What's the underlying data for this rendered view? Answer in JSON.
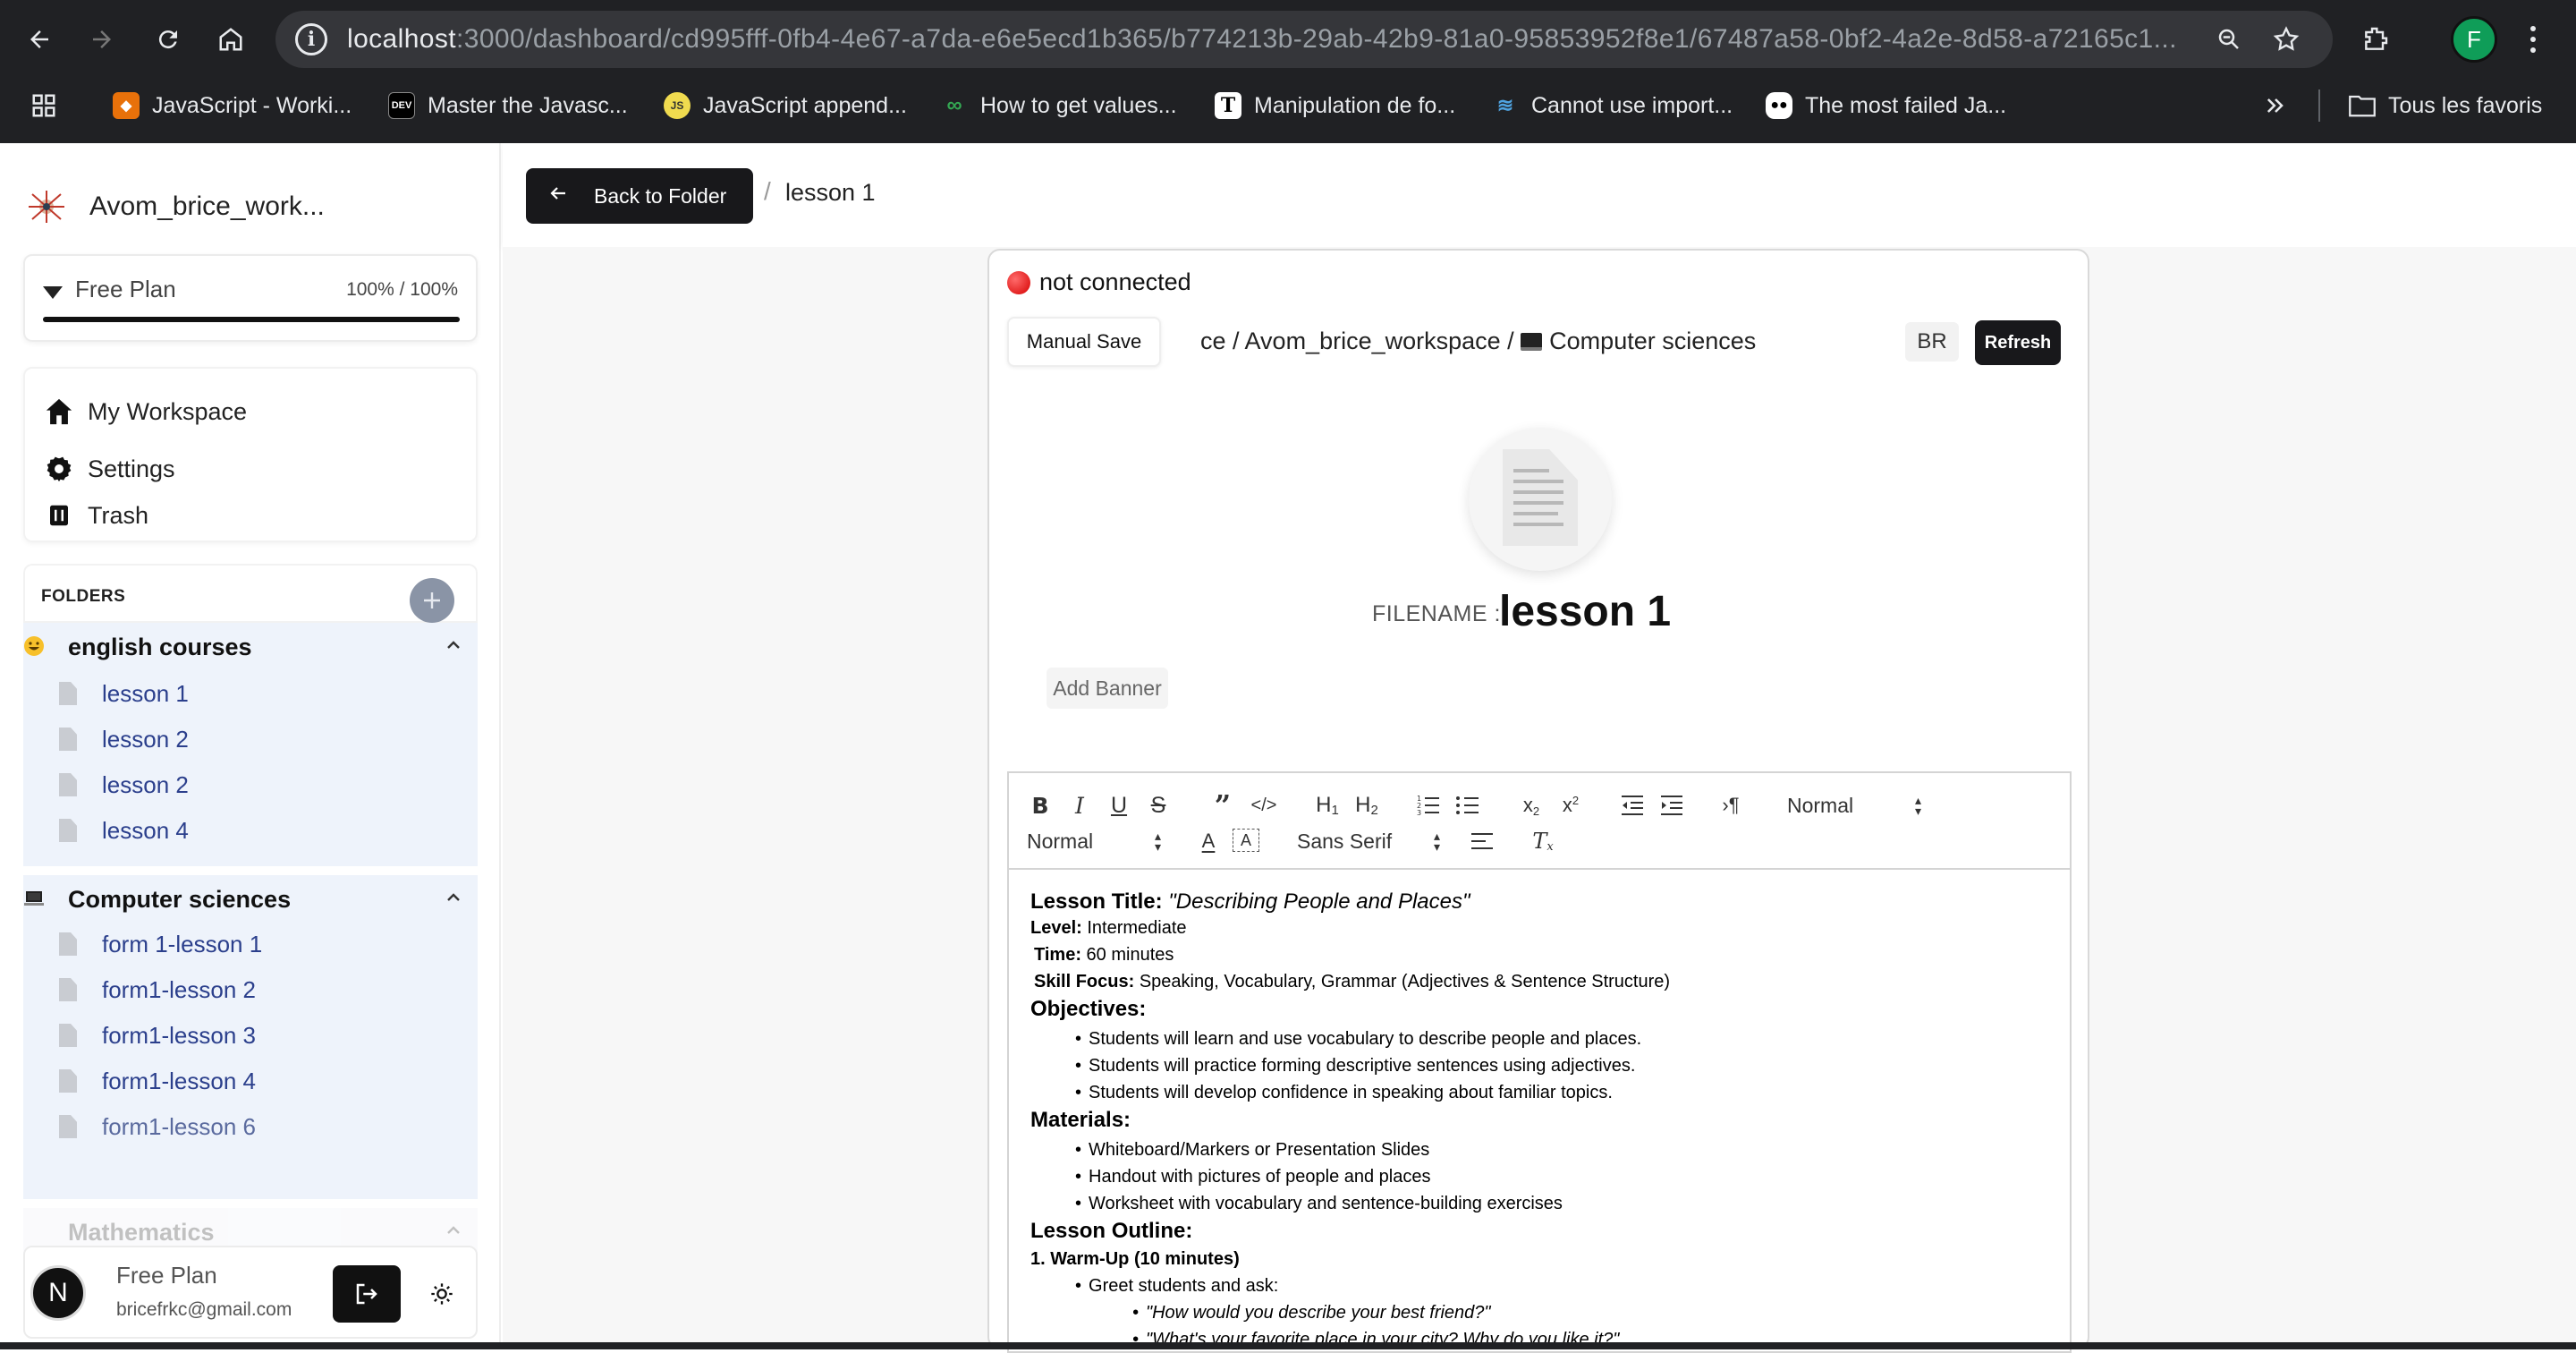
{
  "browser": {
    "url_host": "localhost",
    "url_rest": ":3000/dashboard/cd995fff-0fb4-4e67-a7da-e6e5ecd1b365/b774213b-29ab-42b9-81a0-95853952f8e1/67487a58-0bf2-4a2e-8d58-a72165c1...",
    "profile_initial": "F",
    "bookmarks": [
      {
        "label": "JavaScript - Worki...",
        "icon": "game-controller-icon",
        "color": "#e8710a"
      },
      {
        "label": "Master the Javasc...",
        "icon": "dev-icon",
        "badge": "DEV"
      },
      {
        "label": "JavaScript append...",
        "icon": "js-icon",
        "badge": "JS"
      },
      {
        "label": "How to get values...",
        "icon": "infinity-icon"
      },
      {
        "label": "Manipulation de fo...",
        "icon": "t-icon",
        "badge": "T"
      },
      {
        "label": "Cannot use import...",
        "icon": "stack-icon"
      },
      {
        "label": "The most failed Ja...",
        "icon": "medium-icon"
      }
    ],
    "all_bookmarks_label": "Tous les favoris"
  },
  "sidebar": {
    "workspace_name": "Avom_brice_work...",
    "plan": {
      "label": "Free Plan",
      "usage": "100% / 100%",
      "fill": 1.0
    },
    "nav": [
      {
        "label": "My Workspace",
        "icon": "home-icon"
      },
      {
        "label": "Settings",
        "icon": "gear-icon"
      },
      {
        "label": "Trash",
        "icon": "trash-icon"
      }
    ],
    "folders_title": "FOLDERS",
    "folders": [
      {
        "emoji": "😀",
        "name": "english courses",
        "files": [
          "lesson 1",
          "lesson 2",
          "lesson 2",
          "lesson 4"
        ]
      },
      {
        "emoji": "💻",
        "name": "Computer sciences",
        "files": [
          "form 1-lesson 1",
          "form1-lesson 2",
          "form1-lesson 3",
          "form1-lesson 4",
          "form1-lesson 6"
        ]
      },
      {
        "emoji": "",
        "name": "Mathematics",
        "files": []
      }
    ],
    "user": {
      "initial": "N",
      "plan": "Free Plan",
      "email": "bricefrkc@gmail.com"
    }
  },
  "topbar": {
    "back_label": "Back to Folder",
    "current": "lesson 1"
  },
  "doc": {
    "status": "not connected",
    "manual_save": "Manual Save",
    "path": "ce / Avom_brice_workspace / ",
    "path_folder": "Computer sciences",
    "user_badge": "BR",
    "refresh": "Refresh",
    "filename_label": "FILENAME :",
    "filename": "lesson 1",
    "add_banner": "Add Banner",
    "toolbar": {
      "header_select": "Normal",
      "size_select": "Normal",
      "font_select": "Sans Serif"
    },
    "content": {
      "title_label": "Lesson Title:",
      "title_value": "\"Describing People and Places\"",
      "level_label": "Level:",
      "level_value": "Intermediate",
      "time_label": "Time:",
      "time_value": "60 minutes",
      "skill_label": "Skill Focus:",
      "skill_value": "Speaking, Vocabulary, Grammar (Adjectives & Sentence Structure)",
      "objectives": "Objectives:",
      "objective_items": [
        "Students will learn and use vocabulary to describe people and places.",
        "Students will practice forming descriptive sentences using adjectives.",
        "Students will develop confidence in speaking about familiar topics."
      ],
      "materials": "Materials:",
      "material_items": [
        "Whiteboard/Markers or Presentation Slides",
        "Handout with pictures of people and places",
        "Worksheet with vocabulary and sentence-building exercises"
      ],
      "outline": "Lesson Outline:",
      "warmup": "1. Warm-Up (10 minutes)",
      "warmup_item": "Greet students and ask:",
      "questions": [
        "\"How would you describe your best friend?\"",
        "\"What's your favorite place in your city? Why do you like it?\""
      ]
    }
  }
}
